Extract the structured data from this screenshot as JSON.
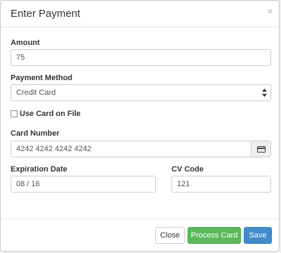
{
  "modal": {
    "title": "Enter Payment",
    "close_glyph": "×"
  },
  "form": {
    "amount": {
      "label": "Amount",
      "value": "75"
    },
    "payment_method": {
      "label": "Payment Method",
      "selected": "Credit Card"
    },
    "use_card_on_file": {
      "label": "Use Card on File",
      "checked": false
    },
    "card_number": {
      "label": "Card Number",
      "value": "4242 4242 4242 4242",
      "addon_icon": "credit-card-icon"
    },
    "expiration_date": {
      "label": "Expiration Date",
      "value": "08 / 16"
    },
    "cv_code": {
      "label": "CV Code",
      "value": "121"
    }
  },
  "footer": {
    "close_label": "Close",
    "process_label": "Process Card",
    "save_label": "Save"
  },
  "colors": {
    "process_button": "#5cb85c",
    "save_button": "#428bca"
  }
}
